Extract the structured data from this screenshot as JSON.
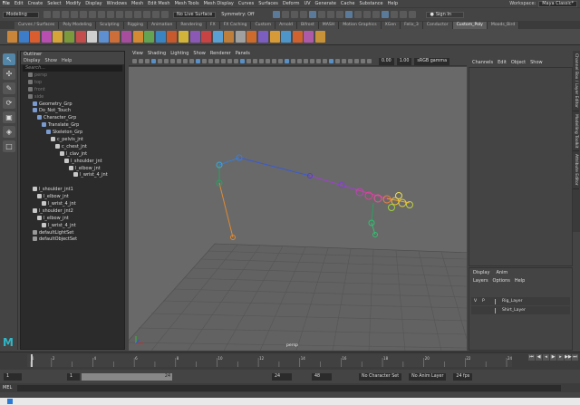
{
  "menubar": {
    "items": [
      "File",
      "Edit",
      "Create",
      "Select",
      "Modify",
      "Display",
      "Windows",
      "Mesh",
      "Edit Mesh",
      "Mesh Tools",
      "Mesh Display",
      "Curves",
      "Surfaces",
      "Deform",
      "UV",
      "Generate",
      "Cache",
      "Substance",
      "Help"
    ],
    "workspace_label": "Workspace:",
    "workspace_value": "Maya Classic*"
  },
  "status": {
    "mode": "Modeling",
    "live_surface": "No Live Surface",
    "symmetry": "Symmetry: Off",
    "sign_in": "Sign In"
  },
  "shelf": {
    "tabs": [
      "Curves / Surfaces",
      "Poly Modeling",
      "Sculpting",
      "Rigging",
      "Animation",
      "Rendering",
      "FX",
      "FX Caching",
      "Custom",
      "Arnold",
      "Bifrost",
      "MASH",
      "Motion Graphics",
      "XGen",
      "Felix_3",
      "Conductor",
      "Custom_Poly",
      "Moods_Bird"
    ],
    "active": "Custom_Poly",
    "icon_colors": [
      "#c9863a",
      "#3c7cc8",
      "#d95d2e",
      "#b84fb0",
      "#d5a53a",
      "#7a9a3b",
      "#c34c4c",
      "#cfcfcf",
      "#5d8fd1",
      "#cc6e3a",
      "#a74d9e",
      "#d48a33",
      "#63a352",
      "#3b84c2",
      "#c65a2e",
      "#d3b43a",
      "#8c58b6",
      "#c84343",
      "#5aa0d3",
      "#bf7e3a",
      "#a0a0a0",
      "#cc6b2c",
      "#7b5ebf",
      "#d69a38",
      "#4e95c9",
      "#d0622f",
      "#ad5aa8",
      "#c89238"
    ]
  },
  "tools": {
    "glyphs": [
      "↖",
      "✣",
      "✎",
      "⟳",
      "▣",
      "◈",
      "□"
    ]
  },
  "outliner": {
    "title": "Outliner",
    "menu": [
      "Display",
      "Show",
      "Help"
    ],
    "search_placeholder": "Search...",
    "items": [
      {
        "label": "persp",
        "dim": true,
        "indent": 0,
        "color": "#777"
      },
      {
        "label": "top",
        "dim": true,
        "indent": 0,
        "color": "#777"
      },
      {
        "label": "front",
        "dim": true,
        "indent": 0,
        "color": "#777"
      },
      {
        "label": "side",
        "dim": true,
        "indent": 0,
        "color": "#777"
      },
      {
        "label": "Geometry_Grp",
        "indent": 1,
        "color": "#7a9bd0"
      },
      {
        "label": "Do_Not_Touch",
        "indent": 1,
        "color": "#7a9bd0"
      },
      {
        "label": "Character_Grp",
        "indent": 2,
        "color": "#7a9bd0"
      },
      {
        "label": "Translate_Grp",
        "indent": 3,
        "color": "#7a9bd0"
      },
      {
        "label": "Skeleton_Grp",
        "indent": 4,
        "color": "#7a9bd0"
      },
      {
        "label": "c_pelvis_jnt",
        "indent": 5,
        "color": "#c8c8c8"
      },
      {
        "label": "c_chest_jnt",
        "indent": 6,
        "color": "#c8c8c8"
      },
      {
        "label": "l_clav_jnt",
        "indent": 7,
        "color": "#c8c8c8"
      },
      {
        "label": "l_shoulder_jnt",
        "indent": 8,
        "color": "#c8c8c8"
      },
      {
        "label": "l_elbow_jnt",
        "indent": 9,
        "color": "#c8c8c8"
      },
      {
        "label": "l_wrist_4_jnt",
        "indent": 10,
        "color": "#c8c8c8"
      },
      {
        "label": "",
        "indent": 0,
        "color": "transparent"
      },
      {
        "label": "l_shoulder_jnt1",
        "indent": 1,
        "color": "#c8c8c8"
      },
      {
        "label": "l_elbow_jnt",
        "indent": 2,
        "color": "#c8c8c8"
      },
      {
        "label": "l_wrist_4_jnt",
        "indent": 3,
        "color": "#c8c8c8"
      },
      {
        "label": "l_shoulder_jnt2",
        "indent": 1,
        "color": "#c8c8c8"
      },
      {
        "label": "l_elbow_jnt",
        "indent": 2,
        "color": "#c8c8c8"
      },
      {
        "label": "l_wrist_4_jnt",
        "indent": 3,
        "color": "#c8c8c8"
      },
      {
        "label": "defaultLightSet",
        "indent": 1,
        "color": "#9a9a9a"
      },
      {
        "label": "defaultObjectSet",
        "indent": 1,
        "color": "#9a9a9a"
      }
    ]
  },
  "viewport": {
    "menu": [
      "View",
      "Shading",
      "Lighting",
      "Show",
      "Renderer",
      "Panels"
    ],
    "value_a": "0.00",
    "value_b": "1.00",
    "color_space": "sRGB gamma",
    "camera": "persp"
  },
  "channelbox": {
    "menu": [
      "Channels",
      "Edit",
      "Object",
      "Show"
    ]
  },
  "layers": {
    "tabs": [
      "Display",
      "Anim"
    ],
    "menu": [
      "Layers",
      "Options",
      "Help"
    ],
    "rows": [
      {
        "v": "V",
        "p": "P",
        "name": "Rig_Layer"
      },
      {
        "v": "",
        "p": "",
        "name": "Shirt_Layer"
      }
    ]
  },
  "sidetabs": [
    "Channel Box / Layer Editor",
    "Modelling Toolkit",
    "Attribute Editor"
  ],
  "timeline": {
    "ticks": [
      "1",
      "2",
      "4",
      "6",
      "8",
      "10",
      "12",
      "14",
      "16",
      "18",
      "20",
      "22",
      "24"
    ],
    "current_frame": "1"
  },
  "range": {
    "start": "1",
    "start_inner": "1",
    "end_inner": "24",
    "end": "24",
    "max": "48",
    "character_set": "No Character Set",
    "anim_layer": "No Anim Layer",
    "fps": "24 fps"
  },
  "cmdline": {
    "lang": "MEL"
  }
}
